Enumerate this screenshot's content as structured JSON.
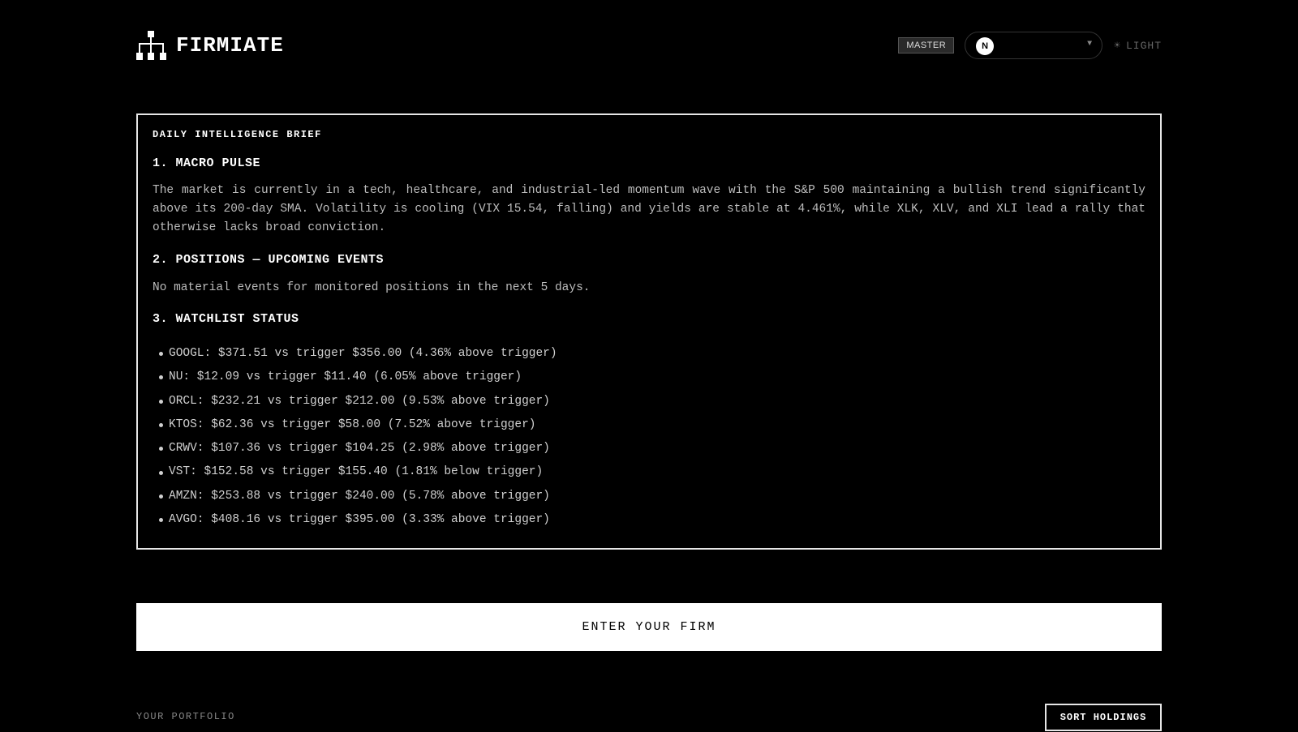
{
  "header": {
    "app_name": "FIRMIATE",
    "logo_icon": "org-chart-icon",
    "role_badge": "MASTER",
    "user_initial": "N",
    "user_name": "",
    "theme_toggle_label": "LIGHT",
    "theme_icon": "sun-icon"
  },
  "brief": {
    "label": "DAILY INTELLIGENCE BRIEF",
    "sections": [
      {
        "heading": "1. MACRO PULSE",
        "body": "The market is currently in a tech, healthcare, and industrial-led momentum wave with the S&P 500 maintaining a bullish trend significantly above its 200-day SMA. Volatility is cooling (VIX 15.54, falling) and yields are stable at 4.461%, while XLK, XLV, and XLI lead a rally that otherwise lacks broad conviction."
      },
      {
        "heading": "2. POSITIONS — UPCOMING EVENTS",
        "body": "No material events for monitored positions in the next 5 days."
      },
      {
        "heading": "3. WATCHLIST STATUS",
        "items": [
          "GOOGL: $371.51 vs trigger $356.00 (4.36% above trigger)",
          "NU: $12.09 vs trigger $11.40 (6.05% above trigger)",
          "ORCL: $232.21 vs trigger $212.00 (9.53% above trigger)",
          "KTOS: $62.36 vs trigger $58.00 (7.52% above trigger)",
          "CRWV: $107.36 vs trigger $104.25 (2.98% above trigger)",
          "VST: $152.58 vs trigger $155.40 (1.81% below trigger)",
          "AMZN: $253.88 vs trigger $240.00 (5.78% above trigger)",
          "AVGO: $408.16 vs trigger $395.00 (3.33% above trigger)"
        ]
      }
    ]
  },
  "actions": {
    "enter_firm_label": "ENTER YOUR FIRM",
    "sort_holdings_label": "SORT HOLDINGS"
  },
  "portfolio": {
    "label": "YOUR PORTFOLIO"
  },
  "colors": {
    "background": "#000000",
    "foreground": "#ffffff",
    "muted_text": "#bdbdbd",
    "border": "#e6e6e6"
  }
}
